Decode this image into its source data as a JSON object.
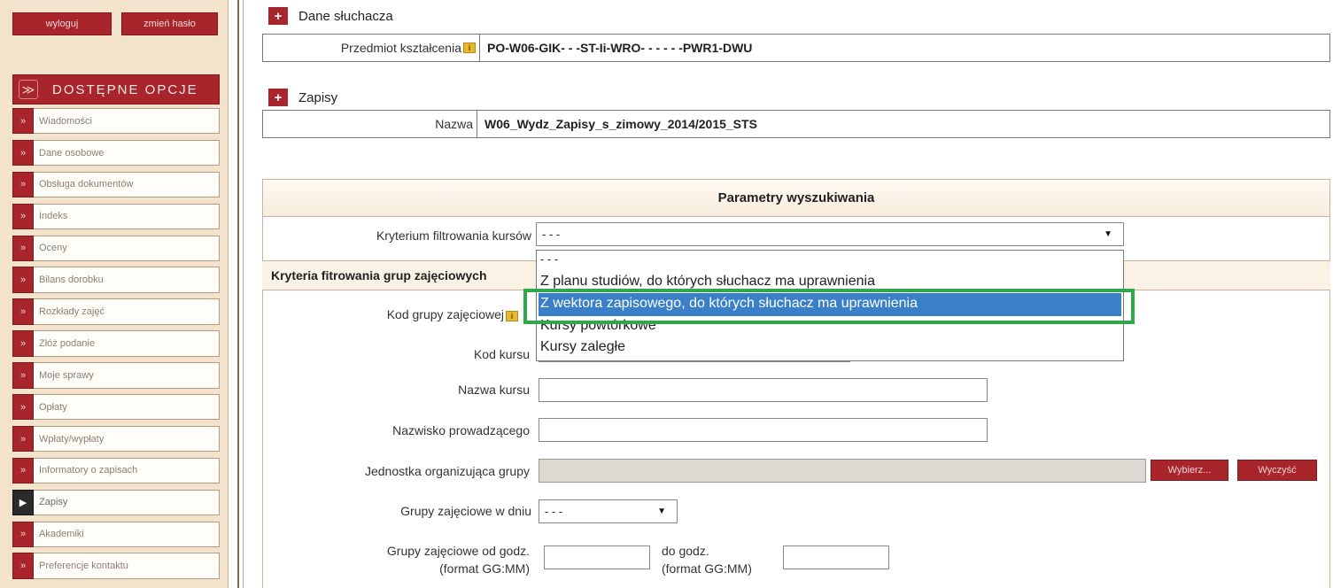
{
  "sidebar": {
    "logout": "wyloguj",
    "change_password": "zmień hasło",
    "options_header": "DOSTĘPNE OPCJE",
    "items": [
      {
        "label": "Wiadomości"
      },
      {
        "label": "Dane osobowe"
      },
      {
        "label": "Obsługa dokumentów"
      },
      {
        "label": "Indeks"
      },
      {
        "label": "Oceny"
      },
      {
        "label": "Bilans dorobku"
      },
      {
        "label": "Rozkłady zajęć"
      },
      {
        "label": "Złóż podanie"
      },
      {
        "label": "Moje sprawy"
      },
      {
        "label": "Opłaty"
      },
      {
        "label": "Wpłaty/wypłaty"
      },
      {
        "label": "Informatory o zapisach"
      },
      {
        "label": "Zapisy"
      },
      {
        "label": "Akademiki"
      },
      {
        "label": "Preferencje kontaktu"
      }
    ]
  },
  "student": {
    "title": "Dane słuchacza",
    "subject_label": "Przedmiot kształcenia",
    "subject_value": "PO-W06-GIK- - -ST-Ii-WRO- - - - - -PWR1-DWU"
  },
  "enrollment": {
    "title": "Zapisy",
    "name_label": "Nazwa",
    "name_value": "W06_Wydz_Zapisy_s_zimowy_2014/2015_STS"
  },
  "params": {
    "title": "Parametry wyszukiwania",
    "course_filter_label": "Kryterium filtrowania kursów",
    "course_filter_value": "- - -",
    "group_filter_title": "Kryteria fitrowania grup zajęciowych",
    "dropdown_options": [
      "- - -",
      "Z planu studiów, do których słuchacz ma uprawnienia",
      "Z wektora zapisowego, do których słuchacz ma uprawnienia",
      "Kursy powtórkowe",
      "Kursy zaległe"
    ],
    "group_code_label": "Kod grupy zajęciowej",
    "course_code_label": "Kod kursu",
    "course_name_label": "Nazwa kursu",
    "teacher_label": "Nazwisko prowadzącego",
    "unit_label": "Jednostka organizująca grupy",
    "choose_btn": "Wybierz...",
    "clear_btn": "Wyczyść",
    "day_label": "Grupy zajęciowe w dniu",
    "day_value": "- - -",
    "from_label_1": "Grupy zajęciowe od godz.",
    "from_label_2": "(format GG:MM)",
    "to_label_1": "do godz.",
    "to_label_2": "(format GG:MM)"
  }
}
